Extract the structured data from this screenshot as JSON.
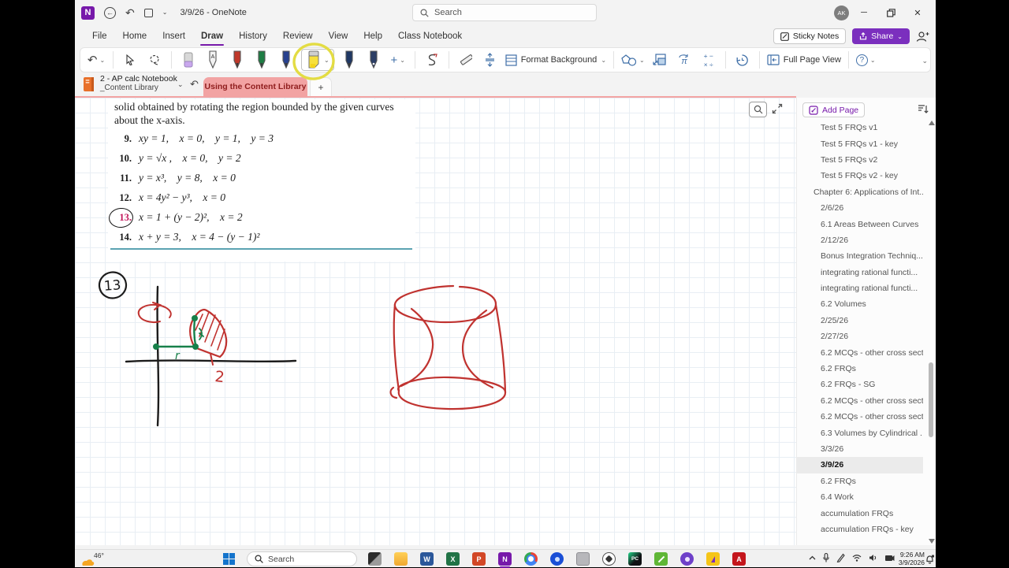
{
  "window": {
    "title": "3/9/26 - OneNote",
    "search_placeholder": "Search",
    "avatar_initials": "AK",
    "minimize": "─",
    "maximize": "❐",
    "close": "✕"
  },
  "menubar": {
    "items": [
      {
        "label": "File"
      },
      {
        "label": "Home"
      },
      {
        "label": "Insert"
      },
      {
        "label": "Draw",
        "active": true
      },
      {
        "label": "History"
      },
      {
        "label": "Review"
      },
      {
        "label": "View"
      },
      {
        "label": "Help"
      },
      {
        "label": "Class Notebook"
      }
    ],
    "sticky_notes_label": "Sticky Notes",
    "share_label": "Share"
  },
  "ribbon": {
    "format_background_label": "Format Background",
    "full_page_view_label": "Full Page View",
    "pen_a_label": "A",
    "math_plus_minus": "+ −",
    "math_times_div": "× ÷",
    "accent_yellow_annotation": "#e3dc43"
  },
  "tab_bar": {
    "notebook_name": "2 - AP calc Notebook",
    "section_group": "_Content Library",
    "active_section": "Using the Content Library",
    "new_section_label": "+",
    "active_tab_color": "#f2a3a3"
  },
  "page": {
    "intro_line1": "solid obtained by rotating the region bounded by the given curves",
    "intro_line2": "about the x-axis.",
    "problems": [
      {
        "num": "9.",
        "formula": "xy = 1, x = 0, y = 1, y = 3"
      },
      {
        "num": "10.",
        "formula": "y = √x , x = 0, y = 2"
      },
      {
        "num": "11.",
        "formula": "y = x³, y = 8, x = 0"
      },
      {
        "num": "12.",
        "formula": "x = 4y² − y³, x = 0"
      },
      {
        "num": "13.",
        "formula": "x = 1 + (y − 2)², x = 2",
        "circled": true
      },
      {
        "num": "14.",
        "formula": "x + y = 3, x = 4 − (y − 1)²"
      }
    ],
    "circled_number_color": "#c2185b"
  },
  "sketch": {
    "problem_label": "13",
    "radius_label": "r",
    "x_value_label": "2",
    "ink_red": "#c03330",
    "ink_green": "#17804a",
    "ink_black": "#1c1c1c"
  },
  "sidebar": {
    "add_page_label": "Add Page",
    "pages": [
      {
        "label": "Test 5 FRQs v1"
      },
      {
        "label": "Test 5 FRQs v1 - key"
      },
      {
        "label": "Test 5 FRQs v2"
      },
      {
        "label": "Test 5 FRQs v2 - key"
      },
      {
        "label": "Chapter 6: Applications of Int...",
        "parent": true
      },
      {
        "label": "2/6/26"
      },
      {
        "label": "6.1 Areas Between Curves"
      },
      {
        "label": "2/12/26"
      },
      {
        "label": "Bonus Integration Techniq..."
      },
      {
        "label": "integrating rational functi..."
      },
      {
        "label": "integrating rational functi..."
      },
      {
        "label": "6.2 Volumes"
      },
      {
        "label": "2/25/26"
      },
      {
        "label": "2/27/26"
      },
      {
        "label": "6.2 MCQs - other cross sect..."
      },
      {
        "label": "6.2 FRQs"
      },
      {
        "label": "6.2 FRQs - SG"
      },
      {
        "label": "6.2 MCQs - other cross sect..."
      },
      {
        "label": "6.2 MCQs - other cross sect..."
      },
      {
        "label": "6.3 Volumes by Cylindrical ..."
      },
      {
        "label": "3/3/26"
      },
      {
        "label": "3/9/26",
        "selected": true
      },
      {
        "label": "6.2 FRQs"
      },
      {
        "label": "6.4 Work"
      },
      {
        "label": "accumulation FRQs"
      },
      {
        "label": "accumulation FRQs - key"
      }
    ]
  },
  "taskbar": {
    "weather_temp": "46°",
    "search_placeholder": "Search",
    "clock_time": "9:26 AM",
    "clock_date": "3/9/2026",
    "apps": [
      {
        "name": "task-view"
      },
      {
        "name": "file-explorer"
      },
      {
        "name": "word",
        "letter": "W"
      },
      {
        "name": "excel",
        "letter": "X"
      },
      {
        "name": "powerpoint",
        "letter": "P"
      },
      {
        "name": "onenote",
        "letter": "N",
        "active": true
      },
      {
        "name": "chrome"
      },
      {
        "name": "app-blue"
      },
      {
        "name": "app-gray"
      },
      {
        "name": "app-flower"
      },
      {
        "name": "pycharm",
        "letter": "PC"
      },
      {
        "name": "app-green"
      },
      {
        "name": "app-purple"
      },
      {
        "name": "app-yellow"
      },
      {
        "name": "acrobat",
        "letter": "A"
      }
    ]
  }
}
